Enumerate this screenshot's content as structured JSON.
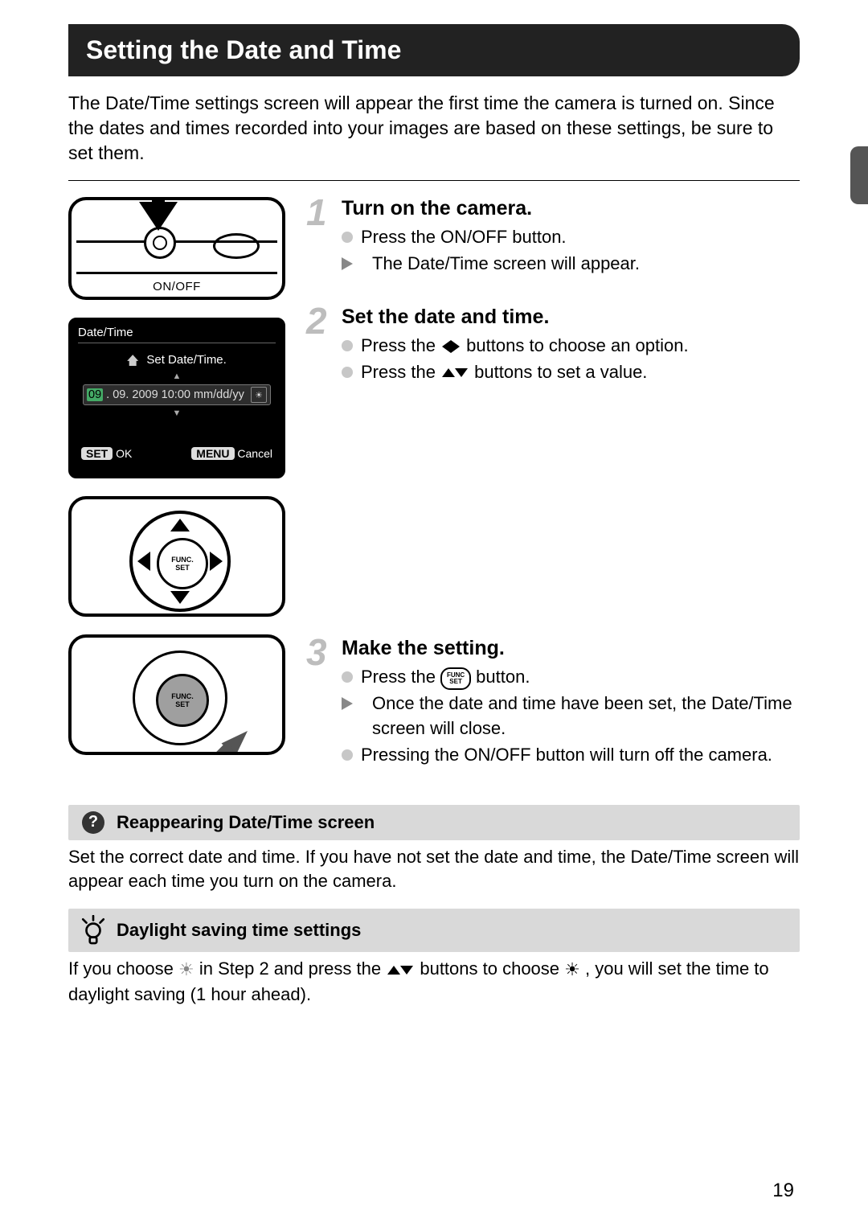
{
  "title": "Setting the Date and Time",
  "intro": "The Date/Time settings screen will appear the first time the camera is turned on. Since the dates and times recorded into your images are based on these settings, be sure to set them.",
  "illus": {
    "onoff_label": "ON/OFF",
    "dt_header": "Date/Time",
    "dt_set_label": "Set Date/Time.",
    "dt_value": "09. 09. 2009 10:00 mm/dd/yy",
    "dt_value_hl": "09",
    "dt_set_ok": "SET",
    "dt_ok": "OK",
    "dt_menu": "MENU",
    "dt_cancel": "Cancel",
    "func_label_top": "FUNC.",
    "func_label_bot": "SET"
  },
  "steps": [
    {
      "num": "1",
      "title": "Turn on the camera.",
      "lines": [
        {
          "type": "dot",
          "text": "Press the ON/OFF button."
        },
        {
          "type": "play",
          "text": "The Date/Time screen will appear."
        }
      ]
    },
    {
      "num": "2",
      "title": "Set the date and time.",
      "lines": [
        {
          "type": "dot",
          "text_before": "Press the ",
          "icon": "lr",
          "text_after": " buttons to choose an option."
        },
        {
          "type": "dot",
          "text_before": "Press the ",
          "icon": "ud",
          "text_after": " buttons to set a value."
        }
      ]
    },
    {
      "num": "3",
      "title": "Make the setting.",
      "lines": [
        {
          "type": "dot",
          "text_before": "Press the ",
          "icon": "func",
          "text_after": " button."
        },
        {
          "type": "play",
          "text": "Once the date and time have been set, the Date/Time screen will close."
        },
        {
          "type": "dot",
          "text": "Pressing the ON/OFF button will turn off the camera."
        }
      ]
    }
  ],
  "callout1_title": "Reappearing Date/Time screen",
  "callout1_body": "Set the correct date and time. If you have not set the date and time, the Date/Time screen will appear each time you turn on the camera.",
  "callout2_title": "Daylight saving time settings",
  "callout2_before": "If you choose ",
  "callout2_mid1": " in Step 2 and press the ",
  "callout2_mid2": " buttons to choose ",
  "callout2_after": ", you will set the time to daylight saving (1 hour ahead).",
  "page_number": "19"
}
